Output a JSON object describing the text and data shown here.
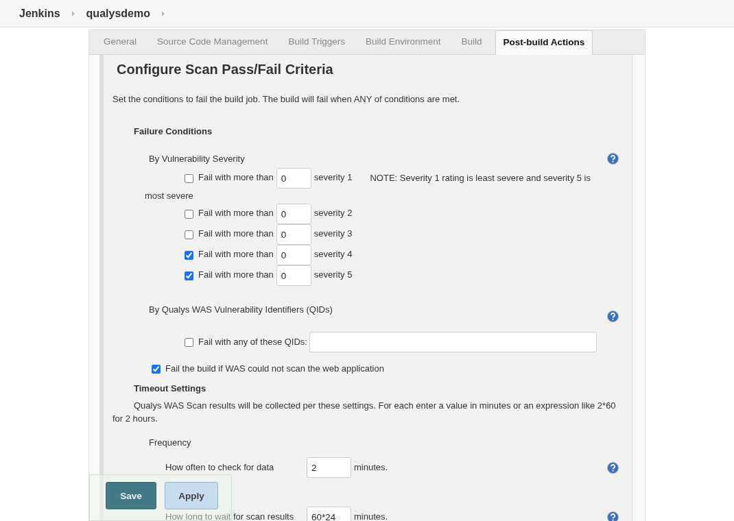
{
  "breadcrumb": [
    "Jenkins",
    "qualysdemo"
  ],
  "tabs": [
    {
      "label": "General",
      "selected": false
    },
    {
      "label": "Source Code Management",
      "selected": false
    },
    {
      "label": "Build Triggers",
      "selected": false
    },
    {
      "label": "Build Environment",
      "selected": false
    },
    {
      "label": "Build",
      "selected": false
    },
    {
      "label": "Post-build Actions",
      "selected": true
    }
  ],
  "section": {
    "title": "Configure Scan Pass/Fail Criteria",
    "description": "Set the conditions to fail the build job. The build will fail when ANY of conditions are met."
  },
  "failure_conditions": {
    "heading": "Failure Conditions",
    "severity_group": {
      "label": "By Vulnerability Severity",
      "help": true,
      "note_lines": [
        "NOTE: Severity 1 rating is least severe and severity 5 is",
        "most severe"
      ],
      "rows": [
        {
          "checked": false,
          "label": "Fail with more than",
          "value": "0",
          "suffix": "severity 1"
        },
        {
          "checked": false,
          "label": "Fail with more than",
          "value": "0",
          "suffix": "severity 2"
        },
        {
          "checked": false,
          "label": "Fail with more than",
          "value": "0",
          "suffix": "severity 3"
        },
        {
          "checked": true,
          "label": "Fail with more than",
          "value": "0",
          "suffix": "severity 4"
        },
        {
          "checked": true,
          "label": "Fail with more than",
          "value": "0",
          "suffix": "severity 5"
        }
      ]
    },
    "qid_group": {
      "label": "By Qualys WAS Vulnerability Identifiers (QIDs)",
      "help": true,
      "checked": false,
      "field_label": "Fail with any of these QIDs:"
    },
    "scan_error": {
      "checked": true,
      "label": "Fail the build if WAS could not scan the web application"
    }
  },
  "timeout": {
    "heading": "Timeout Settings",
    "description": "Qualys WAS Scan results will be collected per these settings. For each enter a value in minutes or an expression like 2*60 for 2 hours.",
    "frequency": {
      "label": "Frequency",
      "help": true,
      "field_label": "How often to check for data",
      "value": "2",
      "suffix": "minutes."
    },
    "wait": {
      "help": true,
      "field_label": "How long to wait for scan results",
      "value": "60*24",
      "suffix": "minutes."
    }
  },
  "footer_buttons": [
    {
      "label": "Save",
      "kind": "primary"
    },
    {
      "label": "Apply",
      "kind": "secondary"
    }
  ]
}
